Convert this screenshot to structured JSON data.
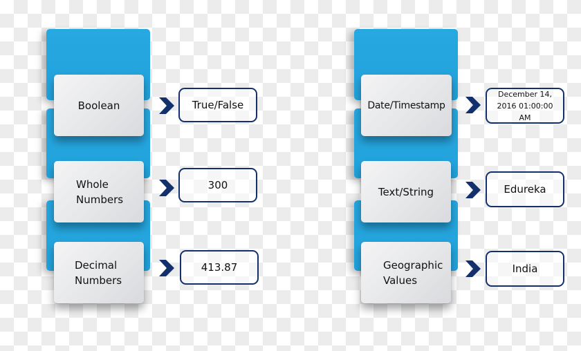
{
  "colors": {
    "tab_blue": "#22a2dc",
    "card_grey": "#e6e7e9",
    "chevron_navy": "#12306b",
    "box_border": "#12306b"
  },
  "columns": [
    {
      "rows": [
        {
          "type": "Boolean",
          "example": "True/False"
        },
        {
          "type": "Whole\nNumbers",
          "example": "300"
        },
        {
          "type": "Decimal\nNumbers",
          "example": "413.87"
        }
      ]
    },
    {
      "rows": [
        {
          "type": "Date/Timestamp",
          "example": "December 14,\n2016 01:00:00\nAM"
        },
        {
          "type": "Text/String",
          "example": "Edureka"
        },
        {
          "type": "Geographic\nValues",
          "example": "India"
        }
      ]
    }
  ]
}
